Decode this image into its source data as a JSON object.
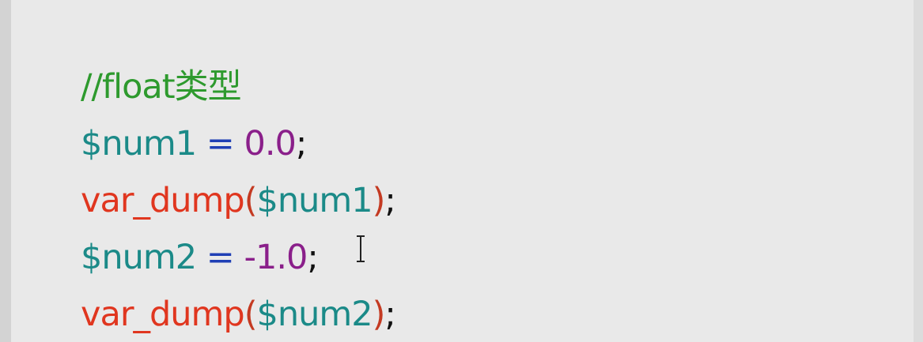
{
  "editor": {
    "lines": [
      {
        "tokens": [
          {
            "text": "//float类型",
            "kind": "comment"
          }
        ]
      },
      {
        "tokens": [
          {
            "text": "$num1",
            "kind": "var"
          },
          {
            "text": " = ",
            "kind": "op"
          },
          {
            "text": "0.0",
            "kind": "num"
          },
          {
            "text": ";",
            "kind": "punct"
          }
        ]
      },
      {
        "tokens": [
          {
            "text": "var_dump",
            "kind": "func"
          },
          {
            "text": "(",
            "kind": "paren"
          },
          {
            "text": "$num1",
            "kind": "var"
          },
          {
            "text": ")",
            "kind": "paren"
          },
          {
            "text": ";",
            "kind": "punct"
          }
        ]
      },
      {
        "tokens": [
          {
            "text": "$num2",
            "kind": "var"
          },
          {
            "text": " = ",
            "kind": "op"
          },
          {
            "text": "-1.0",
            "kind": "num"
          },
          {
            "text": ";",
            "kind": "punct"
          }
        ]
      },
      {
        "tokens": [
          {
            "text": "var_dump",
            "kind": "func"
          },
          {
            "text": "(",
            "kind": "paren"
          },
          {
            "text": "$num2",
            "kind": "var"
          },
          {
            "text": ")",
            "kind": "paren"
          },
          {
            "text": ";",
            "kind": "punct"
          }
        ]
      }
    ]
  },
  "colors": {
    "background": "#e9e9e9",
    "comment": "#2e9a2e",
    "variable": "#1b8a88",
    "operator": "#1f3fb5",
    "number": "#8a1f8a",
    "function": "#e0361f"
  },
  "icons": {
    "cursor": "text-cursor-icon"
  }
}
